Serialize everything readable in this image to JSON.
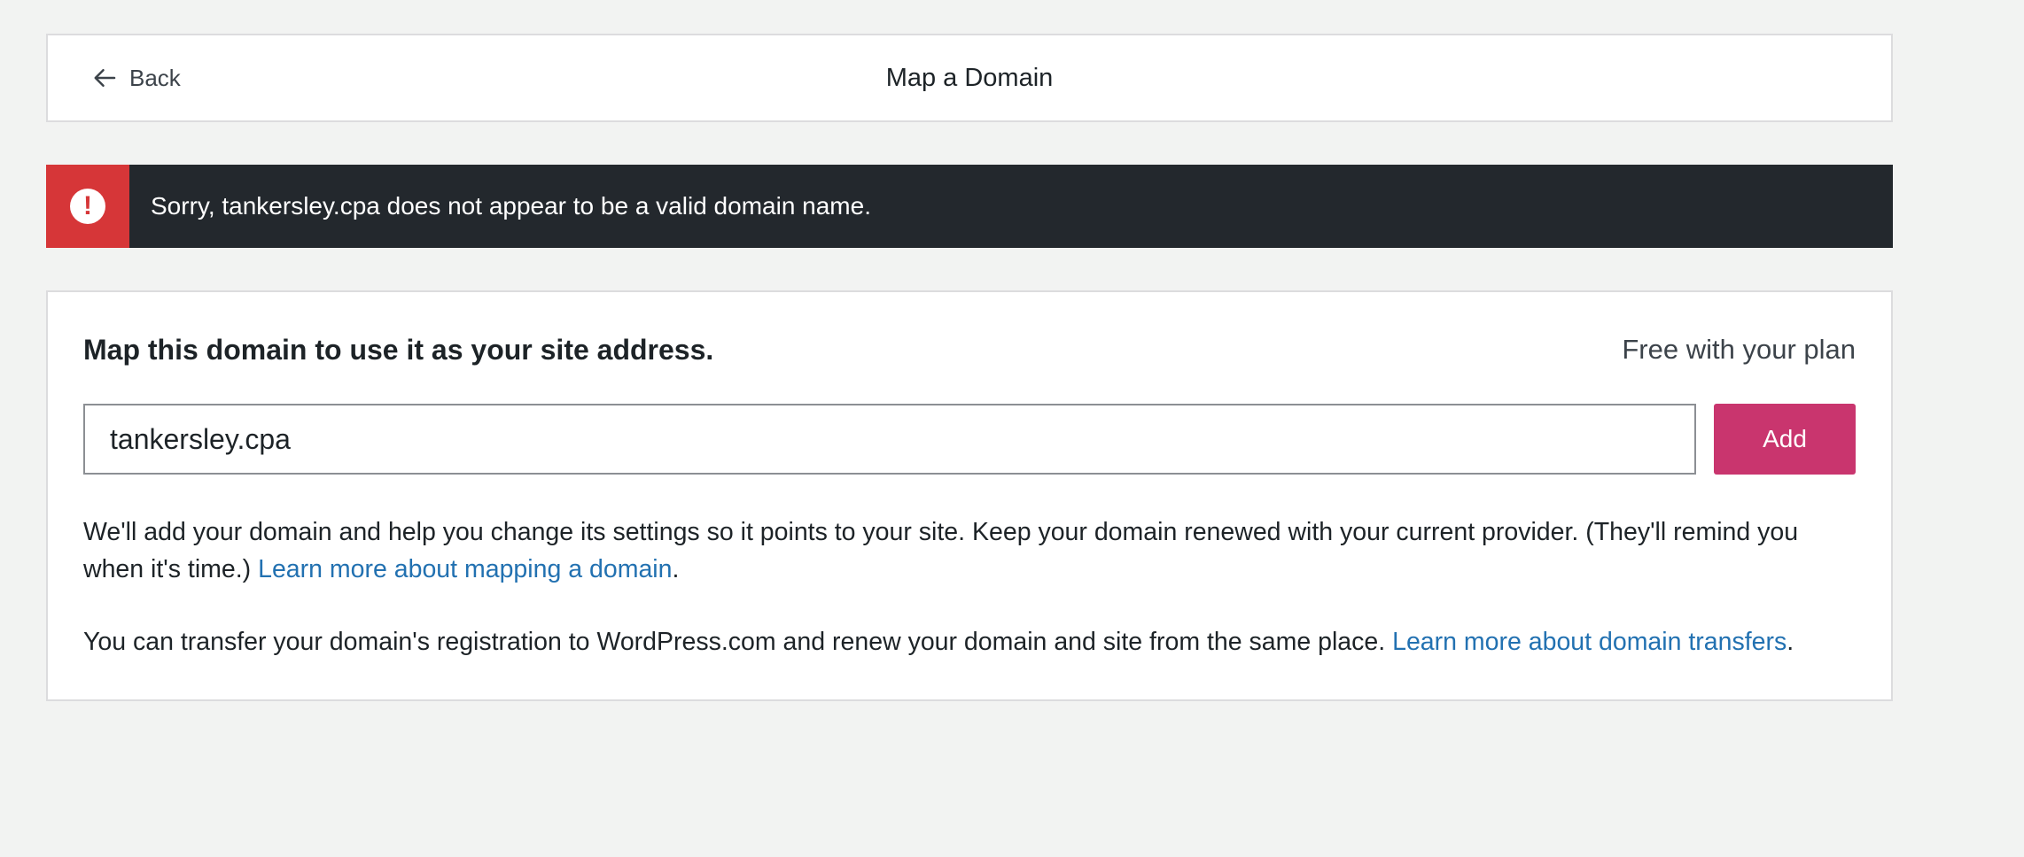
{
  "header": {
    "back_label": "Back",
    "title": "Map a Domain"
  },
  "notice": {
    "icon": "alert-icon",
    "message": "Sorry, tankersley.cpa does not appear to be a valid domain name.",
    "accent_color": "#d63638",
    "background_color": "#23282d"
  },
  "card": {
    "heading": "Map this domain to use it as your site address.",
    "price": "Free with your plan",
    "domain_input": {
      "value": "tankersley.cpa",
      "placeholder": ""
    },
    "add_label": "Add",
    "add_color": "#c9356e",
    "paragraph1": {
      "text": "We'll add your domain and help you change its settings so it points to your site. Keep your domain renewed with your current provider. (They'll remind you when it's time.) ",
      "link": "Learn more about mapping a domain",
      "suffix": "."
    },
    "paragraph2": {
      "text": "You can transfer your domain's registration to WordPress.com and renew your domain and site from the same place. ",
      "link": "Learn more about domain transfers",
      "suffix": "."
    },
    "link_color": "#2271b1"
  }
}
